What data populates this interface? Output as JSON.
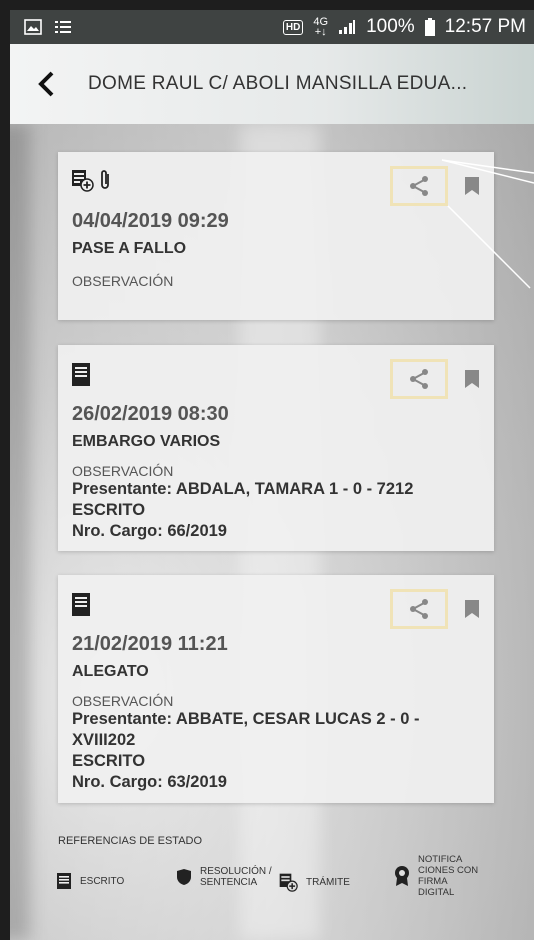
{
  "status": {
    "network_top": "4G",
    "network_bottom": "+↓",
    "hd": "HD",
    "battery": "100%",
    "time": "12:57 PM"
  },
  "appbar": {
    "title": "DOME RAUL C/ ABOLI MANSILLA EDUA..."
  },
  "cards": [
    {
      "date": "04/04/2019 09:29",
      "type": "PASE A FALLO",
      "observation_label": "OBSERVACIÓN",
      "detail": []
    },
    {
      "date": "26/02/2019 08:30",
      "type": "EMBARGO VARIOS",
      "observation_label": "OBSERVACIÓN",
      "detail": [
        "Presentante: ABDALA, TAMARA 1 - 0 - 7212",
        "ESCRITO",
        "Nro. Cargo: 66/2019"
      ]
    },
    {
      "date": "21/02/2019 11:21",
      "type": "ALEGATO",
      "observation_label": "OBSERVACIÓN",
      "detail": [
        "Presentante: ABBATE, CESAR LUCAS 2 - 0 -",
        "XVIII202",
        "ESCRITO",
        "Nro. Cargo: 63/2019"
      ]
    }
  ],
  "legend": {
    "title": "REFERENCIAS DE ESTADO",
    "items": [
      {
        "label": "ESCRITO",
        "icon": "document-icon"
      },
      {
        "label": "RESOLUCIÓN /\nSENTENCIA",
        "icon": "shield-icon"
      },
      {
        "label": "TRÁMITE",
        "icon": "document-add-icon"
      },
      {
        "label": "NOTIFICA\nCIONES CON\nFIRMA\nDIGITAL",
        "icon": "award-icon"
      }
    ]
  },
  "colors": {
    "share_highlight": "#f0e3b7",
    "card_bg": "#f0f0f0",
    "appbar_gradient_end": "#c9d3d1"
  }
}
